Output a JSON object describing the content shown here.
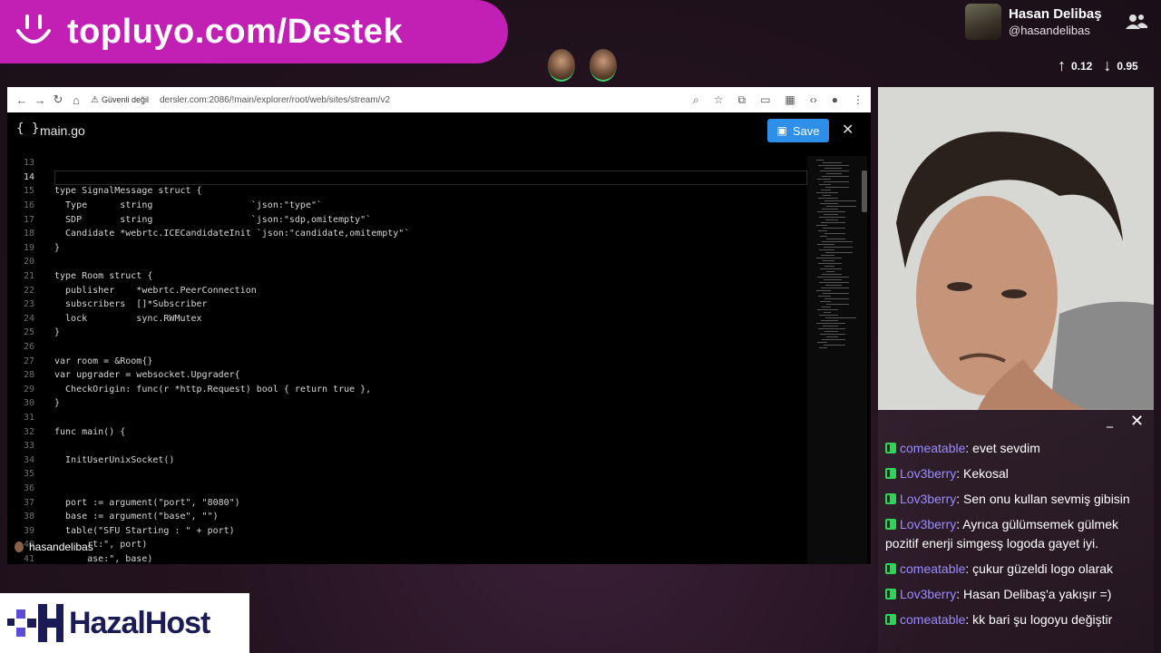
{
  "banner": {
    "text": "topluyo.com/Destek"
  },
  "profile": {
    "name": "Hasan Delibaş",
    "handle": "@hasandelibas",
    "up": "0.12",
    "down": "0.95"
  },
  "browser": {
    "security_label": "Güvenli değil",
    "url": "dersler.com:2086/!main/explorer/root/web/sites/stream/v2"
  },
  "editor": {
    "file_icon": "{ }",
    "filename": "main.go",
    "save_label": "Save",
    "close_label": "✕",
    "lines": [
      {
        "n": "13",
        "t": ""
      },
      {
        "n": "14",
        "t": ""
      },
      {
        "n": "15",
        "t": "type SignalMessage struct {"
      },
      {
        "n": "16",
        "t": "  Type      string                  `json:\"type\"`"
      },
      {
        "n": "17",
        "t": "  SDP       string                  `json:\"sdp,omitempty\"`"
      },
      {
        "n": "18",
        "t": "  Candidate *webrtc.ICECandidateInit `json:\"candidate,omitempty\"`"
      },
      {
        "n": "19",
        "t": "}"
      },
      {
        "n": "20",
        "t": ""
      },
      {
        "n": "21",
        "t": "type Room struct {"
      },
      {
        "n": "22",
        "t": "  publisher    *webrtc.PeerConnection"
      },
      {
        "n": "23",
        "t": "  subscribers  []*Subscriber"
      },
      {
        "n": "24",
        "t": "  lock         sync.RWMutex"
      },
      {
        "n": "25",
        "t": "}"
      },
      {
        "n": "26",
        "t": ""
      },
      {
        "n": "27",
        "t": "var room = &Room{}"
      },
      {
        "n": "28",
        "t": "var upgrader = websocket.Upgrader{"
      },
      {
        "n": "29",
        "t": "  CheckOrigin: func(r *http.Request) bool { return true },"
      },
      {
        "n": "30",
        "t": "}"
      },
      {
        "n": "31",
        "t": ""
      },
      {
        "n": "32",
        "t": "func main() {"
      },
      {
        "n": "33",
        "t": ""
      },
      {
        "n": "34",
        "t": "  InitUserUnixSocket()"
      },
      {
        "n": "35",
        "t": ""
      },
      {
        "n": "36",
        "t": ""
      },
      {
        "n": "37",
        "t": "  port := argument(\"port\", \"8080\")"
      },
      {
        "n": "38",
        "t": "  base := argument(\"base\", \"\")"
      },
      {
        "n": "39",
        "t": "  table(\"SFU Starting : \" + port)"
      },
      {
        "n": "40",
        "t": "      rt:\", port)"
      },
      {
        "n": "41",
        "t": "      ase:\", base)"
      }
    ]
  },
  "overlay_name": "hasandelibas",
  "chat": {
    "messages": [
      {
        "user": "comeatable",
        "text": "evet sevdim"
      },
      {
        "user": "Lov3berry",
        "text": "Kekosal"
      },
      {
        "user": "Lov3berry",
        "text": "Sen onu kullan sevmiş gibisin"
      },
      {
        "user": "Lov3berry",
        "text": "Ayrıca gülümsemek gülmek pozitif enerji simgesş logoda gayet iyi."
      },
      {
        "user": "comeatable",
        "text": "çukur güzeldi logo olarak"
      },
      {
        "user": "Lov3berry",
        "text": "Hasan Delibaş'a yakışır =)"
      },
      {
        "user": "comeatable",
        "text": "kk bari şu logoyu değiştir"
      }
    ]
  },
  "logo": {
    "text": "HazalHost"
  }
}
